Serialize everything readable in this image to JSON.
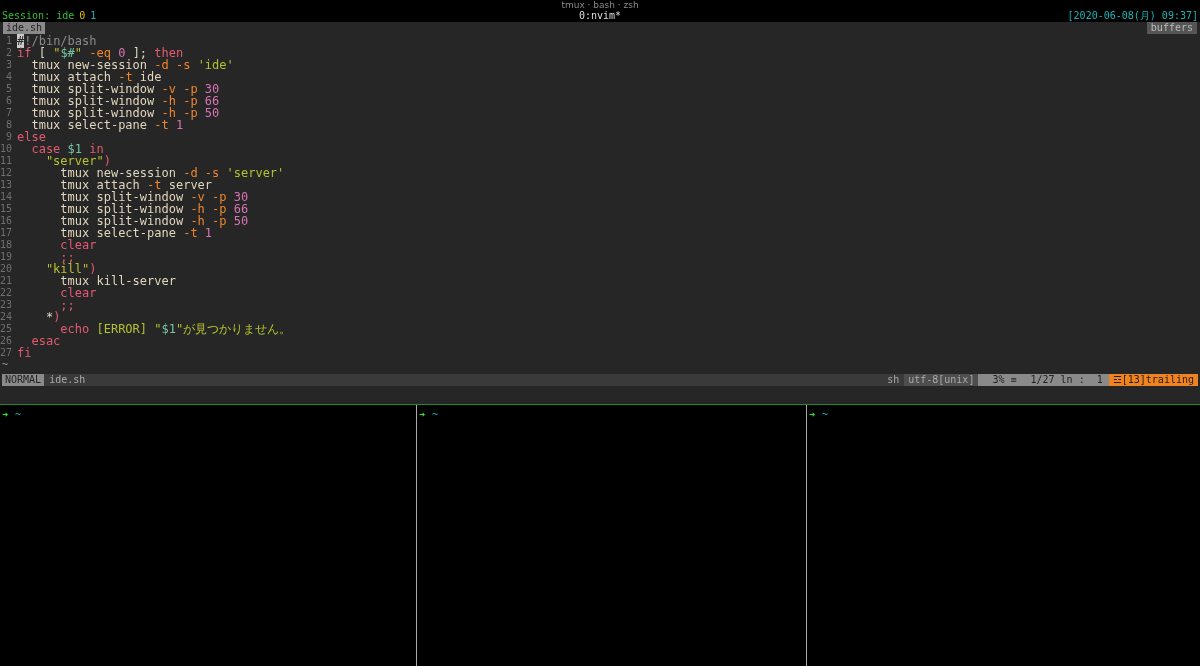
{
  "window": {
    "title": "tmux · bash · zsh"
  },
  "tmux_status": {
    "session": "Session: ide",
    "window_indexes": [
      "0",
      "1"
    ],
    "window_name": "0:nvim*",
    "clock": "[2020-06-08(月) 09:37]"
  },
  "tabline": {
    "tabs": [
      {
        "label": "ide.sh",
        "selected": true
      }
    ],
    "buffers_label": "buffers"
  },
  "code_lines": [
    {
      "number": "1",
      "tokens": [
        {
          "kind": "cursor",
          "text": "#"
        },
        {
          "kind": "comment",
          "text": "!/bin/bash"
        }
      ]
    },
    {
      "number": "2",
      "tokens": [
        {
          "kind": "keyword",
          "text": "if"
        },
        {
          "kind": "plain",
          "text": " [ "
        },
        {
          "kind": "string",
          "text": "\""
        },
        {
          "kind": "variable",
          "text": "$#"
        },
        {
          "kind": "string",
          "text": "\""
        },
        {
          "kind": "flag",
          "text": " -eq"
        },
        {
          "kind": "number",
          "text": " 0"
        },
        {
          "kind": "plain",
          "text": " ]; "
        },
        {
          "kind": "keyword",
          "text": "then"
        }
      ]
    },
    {
      "number": "3",
      "tokens": [
        {
          "kind": "plain",
          "text": "  tmux new-session "
        },
        {
          "kind": "flag",
          "text": "-d -s"
        },
        {
          "kind": "string",
          "text": " 'ide'"
        }
      ]
    },
    {
      "number": "4",
      "tokens": [
        {
          "kind": "plain",
          "text": "  tmux attach "
        },
        {
          "kind": "flag",
          "text": "-t"
        },
        {
          "kind": "plain",
          "text": " ide"
        }
      ]
    },
    {
      "number": "5",
      "tokens": [
        {
          "kind": "plain",
          "text": "  tmux split-window "
        },
        {
          "kind": "flag",
          "text": "-v -p"
        },
        {
          "kind": "number",
          "text": " 30"
        }
      ]
    },
    {
      "number": "6",
      "tokens": [
        {
          "kind": "plain",
          "text": "  tmux split-window "
        },
        {
          "kind": "flag",
          "text": "-h -p"
        },
        {
          "kind": "number",
          "text": " 66"
        }
      ]
    },
    {
      "number": "7",
      "tokens": [
        {
          "kind": "plain",
          "text": "  tmux split-window "
        },
        {
          "kind": "flag",
          "text": "-h -p"
        },
        {
          "kind": "number",
          "text": " 50"
        }
      ]
    },
    {
      "number": "8",
      "tokens": [
        {
          "kind": "plain",
          "text": "  tmux select-pane "
        },
        {
          "kind": "flag",
          "text": "-t"
        },
        {
          "kind": "number",
          "text": " 1"
        }
      ]
    },
    {
      "number": "9",
      "tokens": [
        {
          "kind": "keyword",
          "text": "else"
        }
      ]
    },
    {
      "number": "10",
      "tokens": [
        {
          "kind": "keyword",
          "text": "  case"
        },
        {
          "kind": "variable",
          "text": " $1"
        },
        {
          "kind": "keyword",
          "text": " in"
        }
      ]
    },
    {
      "number": "11",
      "tokens": [
        {
          "kind": "string",
          "text": "    \"server\""
        },
        {
          "kind": "keyword",
          "text": ")"
        }
      ]
    },
    {
      "number": "12",
      "tokens": [
        {
          "kind": "plain",
          "text": "      tmux new-session "
        },
        {
          "kind": "flag",
          "text": "-d -s"
        },
        {
          "kind": "string",
          "text": " 'server'"
        }
      ]
    },
    {
      "number": "13",
      "tokens": [
        {
          "kind": "plain",
          "text": "      tmux attach "
        },
        {
          "kind": "flag",
          "text": "-t"
        },
        {
          "kind": "plain",
          "text": " server"
        }
      ]
    },
    {
      "number": "14",
      "tokens": [
        {
          "kind": "plain",
          "text": "      tmux split-window "
        },
        {
          "kind": "flag",
          "text": "-v -p"
        },
        {
          "kind": "number",
          "text": " 30"
        }
      ]
    },
    {
      "number": "15",
      "tokens": [
        {
          "kind": "plain",
          "text": "      tmux split-window "
        },
        {
          "kind": "flag",
          "text": "-h -p"
        },
        {
          "kind": "number",
          "text": " 66"
        }
      ]
    },
    {
      "number": "16",
      "tokens": [
        {
          "kind": "plain",
          "text": "      tmux split-window "
        },
        {
          "kind": "flag",
          "text": "-h -p"
        },
        {
          "kind": "number",
          "text": " 50"
        }
      ]
    },
    {
      "number": "17",
      "tokens": [
        {
          "kind": "plain",
          "text": "      tmux select-pane "
        },
        {
          "kind": "flag",
          "text": "-t"
        },
        {
          "kind": "number",
          "text": " 1"
        }
      ]
    },
    {
      "number": "18",
      "tokens": [
        {
          "kind": "keyword",
          "text": "      clear"
        }
      ]
    },
    {
      "number": "19",
      "tokens": [
        {
          "kind": "keyword",
          "text": "      ;;"
        }
      ]
    },
    {
      "number": "20",
      "tokens": [
        {
          "kind": "string",
          "text": "    \"kill\""
        },
        {
          "kind": "keyword",
          "text": ")"
        }
      ]
    },
    {
      "number": "21",
      "tokens": [
        {
          "kind": "plain",
          "text": "      tmux kill-server"
        }
      ]
    },
    {
      "number": "22",
      "tokens": [
        {
          "kind": "keyword",
          "text": "      clear"
        }
      ]
    },
    {
      "number": "23",
      "tokens": [
        {
          "kind": "keyword",
          "text": "      ;;"
        }
      ]
    },
    {
      "number": "24",
      "tokens": [
        {
          "kind": "plain",
          "text": "    *"
        },
        {
          "kind": "keyword",
          "text": ")"
        }
      ]
    },
    {
      "number": "25",
      "tokens": [
        {
          "kind": "keyword",
          "text": "      echo"
        },
        {
          "kind": "string",
          "text": " [ERROR] \""
        },
        {
          "kind": "variable",
          "text": "$1"
        },
        {
          "kind": "string",
          "text": "\"が見つかりません。"
        }
      ]
    },
    {
      "number": "26",
      "tokens": [
        {
          "kind": "keyword",
          "text": "  esac"
        }
      ]
    },
    {
      "number": "27",
      "tokens": [
        {
          "kind": "keyword",
          "text": "fi"
        }
      ]
    }
  ],
  "empty_line_marker": "~",
  "vim_status": {
    "mode": "NORMAL",
    "file": "ide.sh",
    "filetype": "sh",
    "encoding": "utf-8[unix]",
    "percent": "3% ≡",
    "position": "1/27 ln :  1",
    "warning": "☲[13]trailing"
  },
  "panes": [
    {
      "prompt": "➜",
      "cwd": "~"
    },
    {
      "prompt": "➜",
      "cwd": "~"
    },
    {
      "prompt": "➜",
      "cwd": "~"
    }
  ]
}
